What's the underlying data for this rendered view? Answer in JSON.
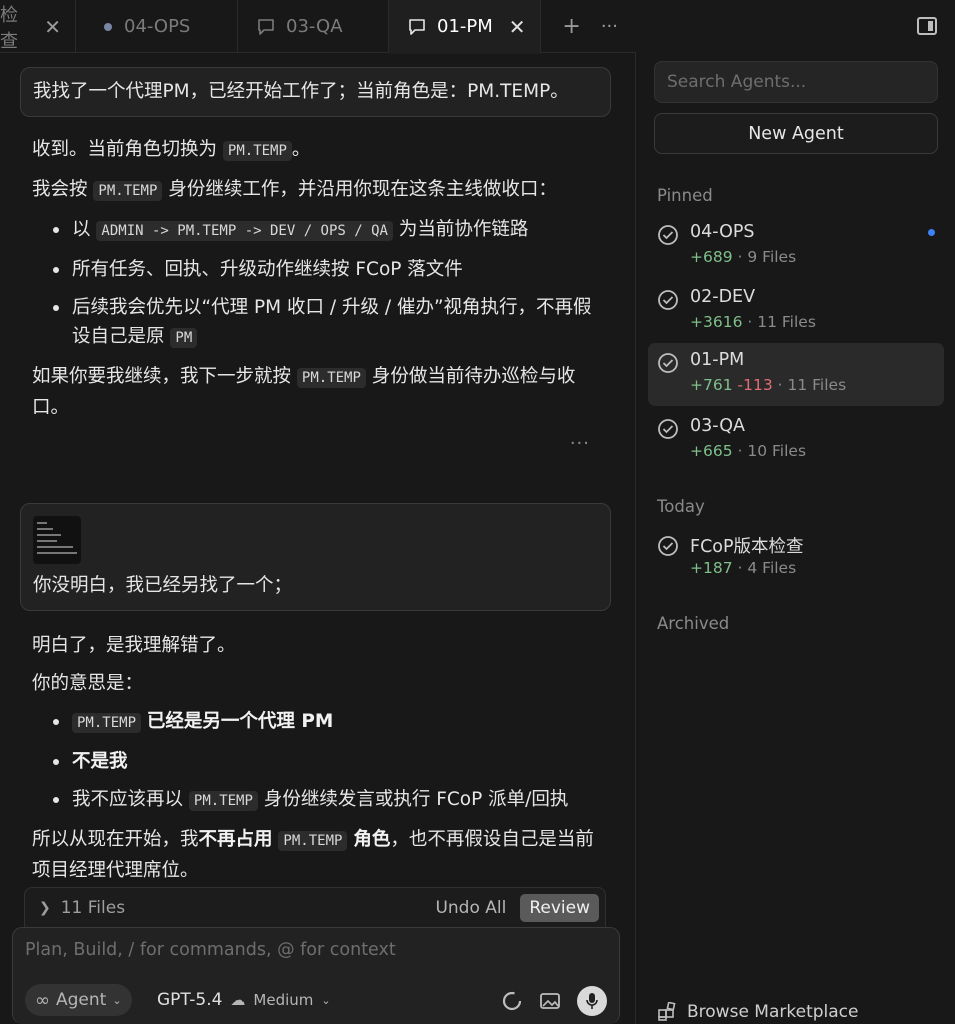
{
  "tabs": [
    {
      "label": "检查",
      "active": false
    },
    {
      "label": "04-OPS",
      "active": false
    },
    {
      "label": "03-QA",
      "active": false
    },
    {
      "label": "01-PM",
      "active": true
    }
  ],
  "chat": {
    "msg1": "我找了一个代理PM，已经开始工作了；当前角色是：PM.TEMP。",
    "resp1": {
      "p1_pre": "收到。当前角色切换为",
      "p1_code": "PM.TEMP",
      "p1_post": "。",
      "p2_pre": "我会按",
      "p2_code": "PM.TEMP",
      "p2_post": "身份继续工作，并沿用你现在这条主线做收口：",
      "b1_pre": "以",
      "b1_code": "ADMIN -> PM.TEMP -> DEV / OPS / QA",
      "b1_post": "为当前协作链路",
      "b2": "所有任务、回执、升级动作继续按 FCoP 落文件",
      "b3_pre": "后续我会优先以“代理 PM 收口 / 升级 / 催办”视角执行，不再假设自己是原",
      "b3_code": "PM",
      "p3_pre": "如果你要我继续，我下一步就按",
      "p3_code": "PM.TEMP",
      "p3_post": "身份做当前待办巡检与收口。"
    },
    "more": "···",
    "msg2": "你没明白，我已经另找了一个；",
    "resp2": {
      "p1": "明白了，是我理解错了。",
      "p2": "你的意思是：",
      "b1_code": "PM.TEMP",
      "b1_bold": "已经是另一个代理 PM",
      "b2_bold": "不是我",
      "b3_pre": "我不应该再以",
      "b3_code": "PM.TEMP",
      "b3_post": "身份继续发言或执行 FCoP 派单/回执",
      "p3_pre": "所以从现在开始，我",
      "p3_bold1": "不再占用",
      "p3_code": "PM.TEMP",
      "p3_bold2": "角色",
      "p3_post": "，也不再假设自己是当前项目经理代理席位。"
    }
  },
  "files_bar": {
    "label": "11 Files",
    "undo": "Undo All",
    "review": "Review"
  },
  "composer": {
    "placeholder": "Plan, Build, / for commands, @ for context",
    "agent": "Agent",
    "model": "GPT-5.4",
    "effort": "Medium"
  },
  "sidebar": {
    "search_placeholder": "Search Agents...",
    "new_agent": "New Agent",
    "sections": {
      "pinned": "Pinned",
      "today": "Today",
      "archived": "Archived"
    },
    "agents": [
      {
        "name": "04-OPS",
        "add": "+689",
        "del": "",
        "files": "· 9 Files",
        "unread": true
      },
      {
        "name": "02-DEV",
        "add": "+3616",
        "del": "",
        "files": "· 11 Files",
        "unread": false
      },
      {
        "name": "01-PM",
        "add": "+761",
        "del": "-113",
        "files": "· 11 Files",
        "unread": false,
        "active": true
      },
      {
        "name": "03-QA",
        "add": "+665",
        "del": "",
        "files": "· 10 Files",
        "unread": false
      }
    ],
    "today_agents": [
      {
        "name": "FCoP版本检查",
        "add": "+187",
        "files": "· 4 Files"
      }
    ],
    "marketplace": "Browse Marketplace"
  }
}
